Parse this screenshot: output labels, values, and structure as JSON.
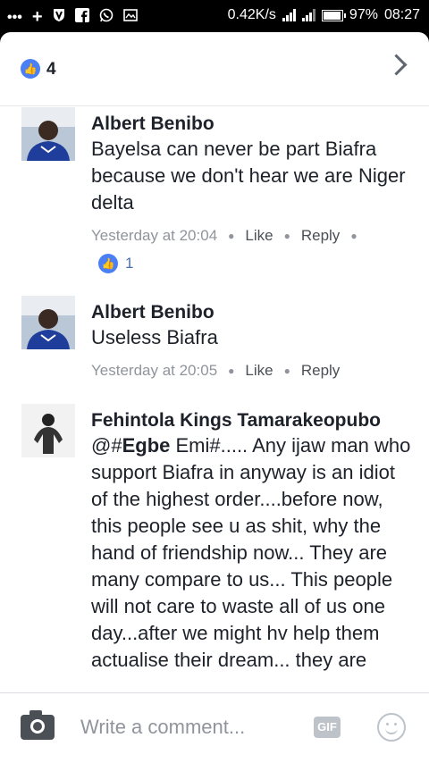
{
  "statusbar": {
    "left_icons": [
      "more-icon",
      "plus-icon",
      "shield-icon",
      "facebook-icon",
      "whatsapp-icon",
      "image-icon"
    ],
    "speed": "0.42K/s",
    "battery": "97%",
    "time": "08:27"
  },
  "header": {
    "like_count": "4"
  },
  "comments": [
    {
      "author": "Albert Benibo",
      "text": "Bayelsa can never be part Biafra because we don't hear we are Niger delta",
      "time": "Yesterday at 20:04",
      "like_label": "Like",
      "reply_label": "Reply",
      "reaction_count": "1"
    },
    {
      "author": "Albert Benibo",
      "text": "Useless Biafra",
      "time": "Yesterday at 20:05",
      "like_label": "Like",
      "reply_label": "Reply"
    },
    {
      "author": "Fehintola Kings Tamarakeopubo",
      "mention_prefix": "@#",
      "mention": "Egbe",
      "text": " Emi#..... Any ijaw man who support Biafra in anyway is an idiot of the highest order....before now, this people see u as shit, why the hand of friendship now... They are many compare to us... This people will not care to waste all of us one day...after we might hv help them actualise their dream... they are"
    }
  ],
  "composer": {
    "placeholder": "Write a comment...",
    "gif_label": "GIF"
  },
  "colors": {
    "accent": "#4a7ff5",
    "text": "#1d2129",
    "muted": "#90949c"
  }
}
